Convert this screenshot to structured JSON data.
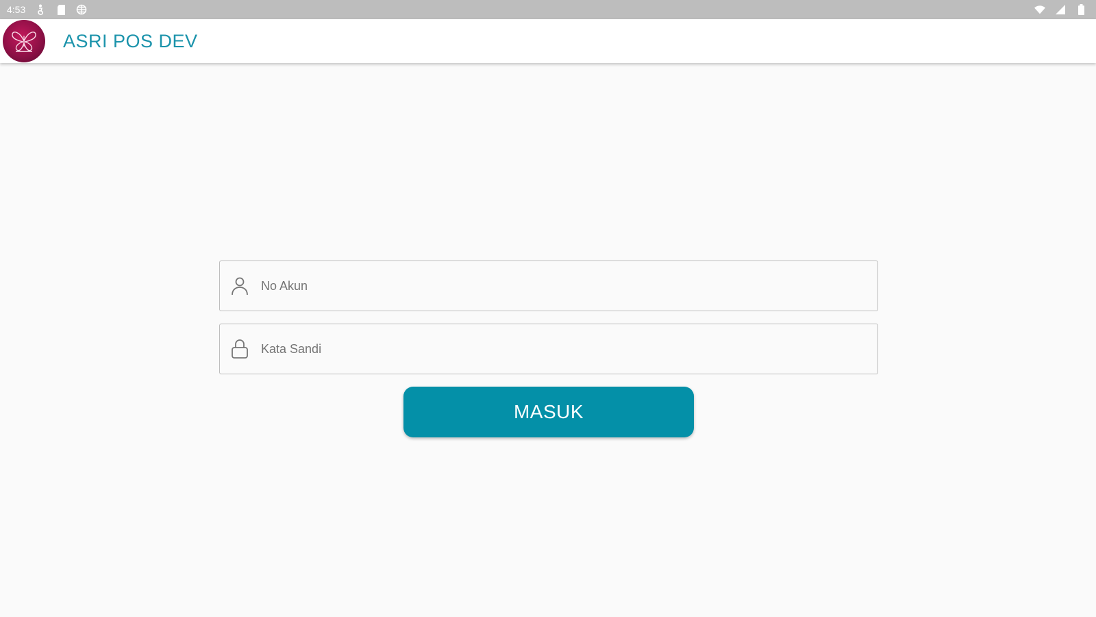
{
  "status_bar": {
    "time": "4:53",
    "left_icons": [
      "accessibility-icon",
      "sd-card-icon",
      "globe-icon"
    ],
    "right_icons": [
      "wifi-icon",
      "signal-icon",
      "battery-icon"
    ]
  },
  "app_bar": {
    "title": "ASRI POS DEV",
    "logo_icon": "butterfly-logo-icon"
  },
  "login_form": {
    "account_field": {
      "placeholder": "No Akun",
      "value": "",
      "icon": "person-icon"
    },
    "password_field": {
      "placeholder": "Kata Sandi",
      "value": "",
      "icon": "lock-icon"
    },
    "submit_label": "MASUK"
  },
  "colors": {
    "accent": "#0490a8",
    "title": "#1b93ab",
    "status_bar": "#bdbdbd",
    "background": "#fafafa",
    "logo": "#8e1046"
  }
}
